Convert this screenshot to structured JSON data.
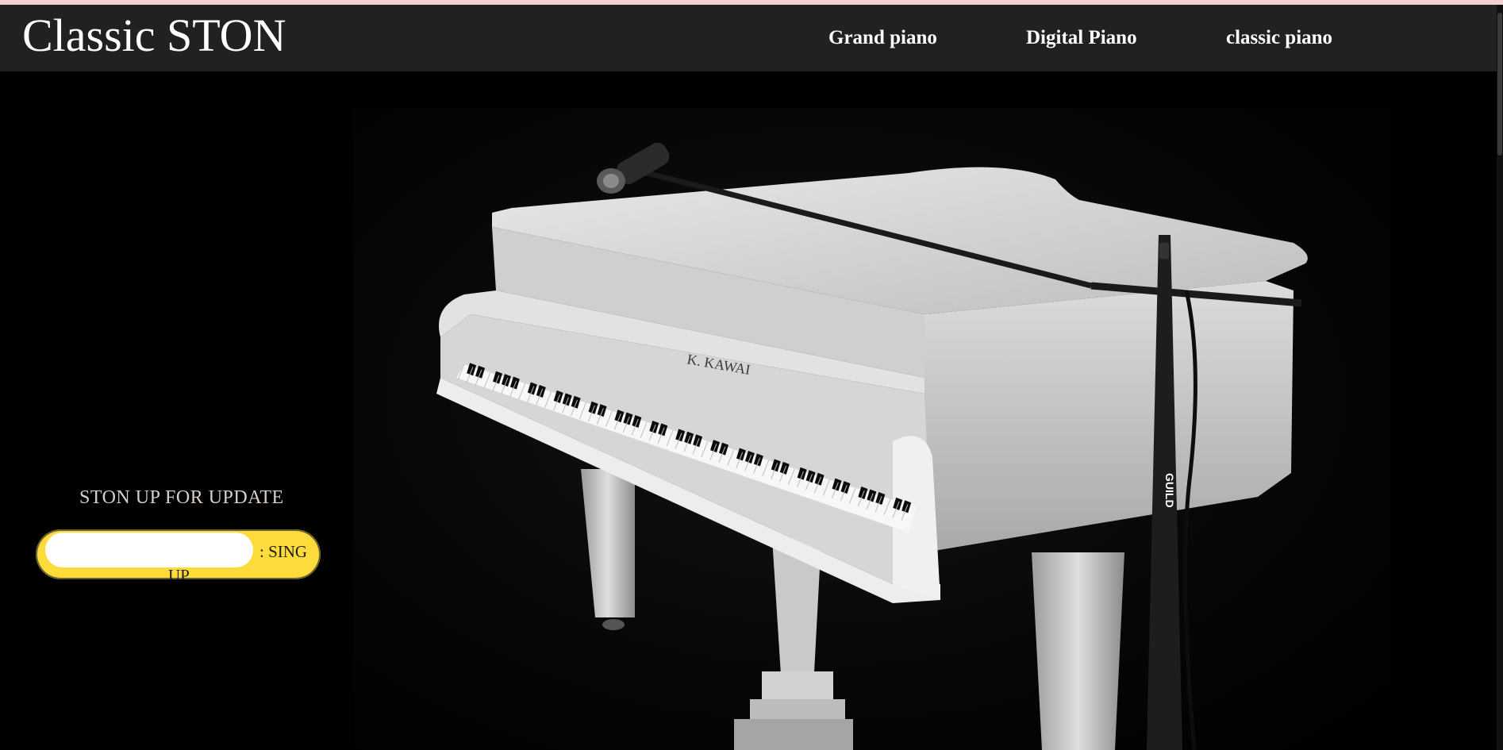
{
  "header": {
    "brand": "Classic STON",
    "nav": [
      {
        "label": "Grand piano"
      },
      {
        "label": "Digital Piano"
      },
      {
        "label": "classic piano"
      }
    ]
  },
  "hero": {
    "piano_brand_text": "K. KAWAI",
    "stand_text": "GUILD"
  },
  "signup": {
    "title": "STON UP FOR UPDATE",
    "input_value": "",
    "input_placeholder": "",
    "button_label": ": SING",
    "button_label_wrap": "UP"
  },
  "colors": {
    "navbar_bg": "#212121",
    "page_bg": "#000000",
    "signup_pill": "#fcdb3a",
    "top_strip": "#f4cfd3"
  }
}
